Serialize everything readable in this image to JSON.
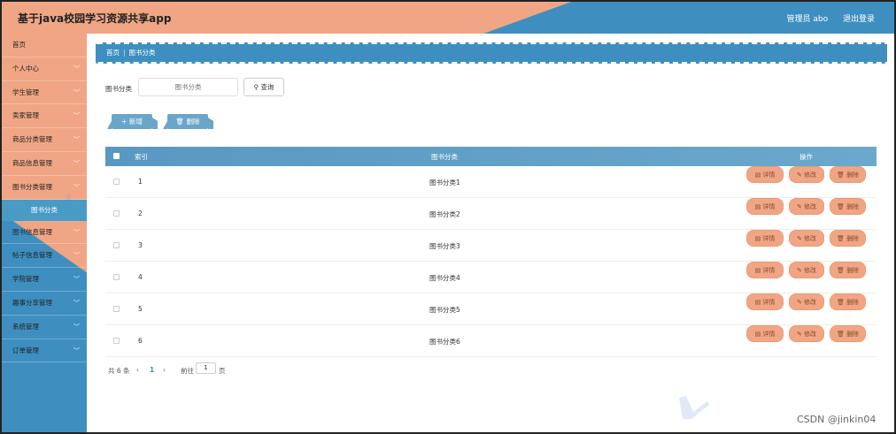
{
  "header": {
    "title": "基于java校园学习资源共享app",
    "admin_label": "管理员 abo",
    "logout_label": "退出登录"
  },
  "sidebar": {
    "items": [
      {
        "label": "首页",
        "has_chevron": false
      },
      {
        "label": "个人中心",
        "has_chevron": true
      },
      {
        "label": "学生管理",
        "has_chevron": true
      },
      {
        "label": "卖家管理",
        "has_chevron": true
      },
      {
        "label": "商品分类管理",
        "has_chevron": true
      },
      {
        "label": "商品信息管理",
        "has_chevron": true
      },
      {
        "label": "图书分类管理",
        "has_chevron": true
      },
      {
        "label": "图书信息管理",
        "has_chevron": true
      },
      {
        "label": "帖子信息管理",
        "has_chevron": true
      },
      {
        "label": "学院管理",
        "has_chevron": true
      },
      {
        "label": "趣事分享管理",
        "has_chevron": true
      },
      {
        "label": "系统管理",
        "has_chevron": true
      },
      {
        "label": "订单管理",
        "has_chevron": true
      }
    ],
    "submenu": {
      "label": "图书分类"
    }
  },
  "breadcrumb": {
    "home": "首页",
    "current": "图书分类"
  },
  "search": {
    "label": "图书分类",
    "placeholder": "图书分类",
    "button": "查询"
  },
  "actions": {
    "add": "新增",
    "delete": "删除"
  },
  "table": {
    "headers": {
      "index": "索引",
      "category": "图书分类",
      "ops": "操作"
    },
    "rows": [
      {
        "index": "1",
        "category": "图书分类1"
      },
      {
        "index": "2",
        "category": "图书分类2"
      },
      {
        "index": "3",
        "category": "图书分类3"
      },
      {
        "index": "4",
        "category": "图书分类4"
      },
      {
        "index": "5",
        "category": "图书分类5"
      },
      {
        "index": "6",
        "category": "图书分类6"
      }
    ],
    "row_ops": {
      "detail": "详情",
      "edit": "修改",
      "delete": "删除"
    }
  },
  "pagination": {
    "total": "共 6 条",
    "prev": "‹",
    "page": "1",
    "next": "›",
    "goto_prefix": "前往",
    "goto_value": "1",
    "goto_suffix": "页"
  },
  "footer": {
    "watermark_text": "CSDN @jinkin04"
  },
  "colors": {
    "accent_blue": "#3e8fc0",
    "accent_orange": "#f0a684"
  }
}
